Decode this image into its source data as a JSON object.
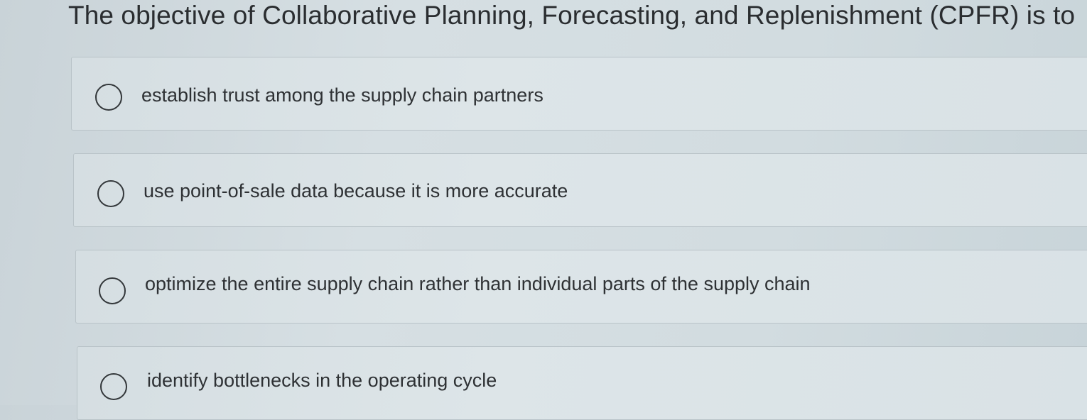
{
  "question": {
    "text": "The objective of Collaborative Planning, Forecasting, and Replenishment (CPFR) is to"
  },
  "options": [
    {
      "label": "establish trust among the supply chain partners",
      "selected": false
    },
    {
      "label": "use point-of-sale data because it is more accurate",
      "selected": false
    },
    {
      "label": "optimize the entire supply chain rather than individual parts of the supply chain",
      "selected": false
    },
    {
      "label": "identify bottlenecks in the operating cycle",
      "selected": false
    }
  ],
  "icons": {
    "radio": "radio-unselected-icon"
  },
  "colors": {
    "background": "#d3dce0",
    "text": "#2b2e31",
    "border": "#b9c3c8"
  }
}
